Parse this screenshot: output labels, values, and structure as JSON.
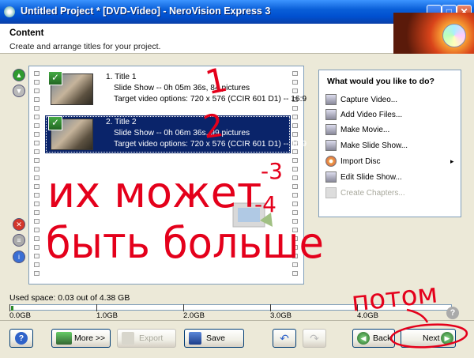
{
  "window": {
    "title": "Untitled Project * [DVD-Video] - NeroVision Express 3",
    "controls": [
      "minimize",
      "maximize",
      "close"
    ]
  },
  "header": {
    "title": "Content",
    "subtitle": "Create and arrange titles for your project."
  },
  "titles": [
    {
      "name": "1. Title 1",
      "info": "Slide Show -- 0h 05m 36s, 84 pictures",
      "options": "Target video options: 720 x 576 (CCIR 601 D1) -- 16:9",
      "selected": false
    },
    {
      "name": "2. Title 2",
      "info": "Slide Show -- 0h 06m 36s, 99 pictures",
      "options": "Target video options: 720 x 576 (CCIR 601 D1) -- 16:9",
      "selected": true
    }
  ],
  "tasks": {
    "heading": "What would you like to do?",
    "items": [
      {
        "label": "Capture Video...",
        "icon": "capture-video-icon",
        "enabled": true
      },
      {
        "label": "Add Video Files...",
        "icon": "add-video-files-icon",
        "enabled": true
      },
      {
        "label": "Make Movie...",
        "icon": "make-movie-icon",
        "enabled": true
      },
      {
        "label": "Make Slide Show...",
        "icon": "make-slide-show-icon",
        "enabled": true
      },
      {
        "label": "Import Disc",
        "icon": "import-disc-icon",
        "enabled": true,
        "submenu": "▸"
      },
      {
        "label": "Edit Slide Show...",
        "icon": "edit-slide-show-icon",
        "enabled": true
      },
      {
        "label": "Create Chapters...",
        "icon": "create-chapters-icon",
        "enabled": false
      }
    ]
  },
  "usage": {
    "label": "Used space: 0.03 out of 4.38 GB",
    "used_gb": 0.03,
    "ticks": [
      "0.0GB",
      "1.0GB",
      "2.0GB",
      "3.0GB",
      "4.0GB"
    ]
  },
  "buttons": {
    "help": "?",
    "more": "More >>",
    "export": "Export",
    "save": "Save",
    "back": "Back",
    "next": "Next"
  },
  "annotations": {
    "num1": "1",
    "num2": "2",
    "num3": "-3",
    "num4": "-4",
    "line1": "их может",
    "line2": "быть больше",
    "potom": "потом"
  },
  "colors": {
    "selection": "#0a246a",
    "annotation": "#e4001b",
    "titlebar": "#0050d0"
  }
}
